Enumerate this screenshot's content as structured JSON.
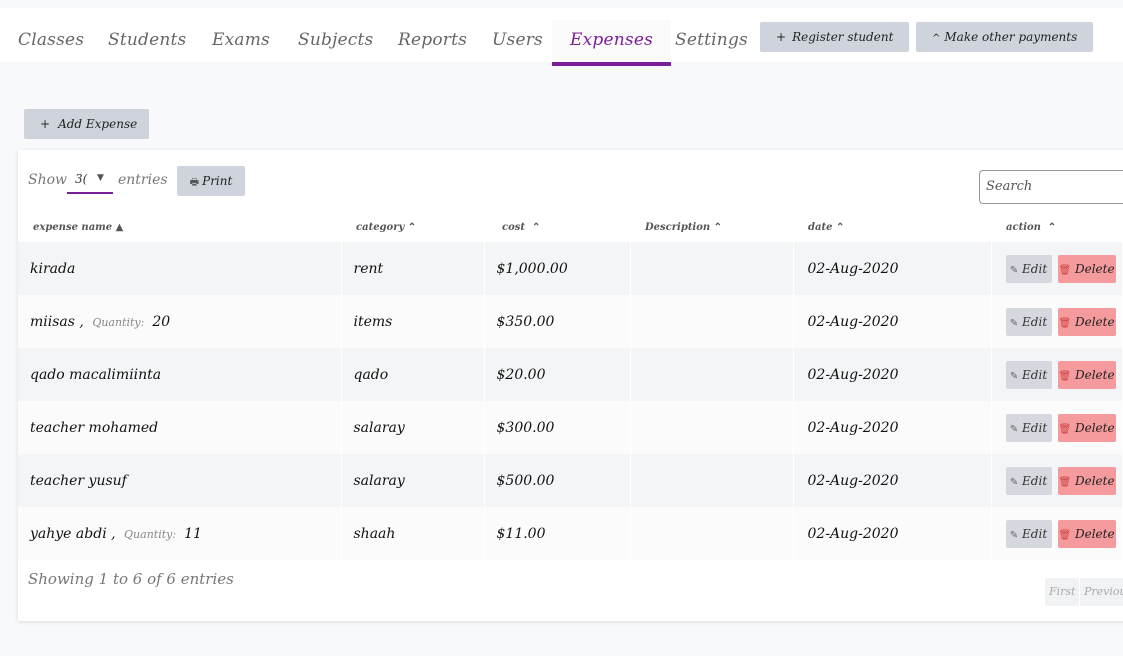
{
  "nav": {
    "tabs": [
      "Classes",
      "Students",
      "Exams",
      "Subjects",
      "Reports",
      "Users",
      "Expenses",
      "Settings"
    ],
    "active_tab": "Expenses",
    "register_label": "Register student",
    "register_icon": "+",
    "other_payments_label": "Make other payments",
    "other_payments_icon": "^"
  },
  "add_expense": {
    "icon": "+",
    "label": "Add Expense"
  },
  "table_controls": {
    "show_label": "Show",
    "page_size": "3(",
    "entries_label": "entries",
    "print_label": "Print",
    "search_placeholder": "Search"
  },
  "columns": [
    "expense name",
    "category",
    "cost",
    "Description",
    "date",
    "action"
  ],
  "rows": [
    {
      "name": "kirada",
      "quantity_label": "",
      "quantity": "",
      "category": "rent",
      "cost": "$1,000.00",
      "description": "",
      "date": "02-Aug-2020"
    },
    {
      "name": "miisas ,",
      "quantity_label": "Quantity:",
      "quantity": "20",
      "category": "items",
      "cost": "$350.00",
      "description": "",
      "date": "02-Aug-2020"
    },
    {
      "name": "qado macalimiinta",
      "quantity_label": "",
      "quantity": "",
      "category": "qado",
      "cost": "$20.00",
      "description": "",
      "date": "02-Aug-2020"
    },
    {
      "name": "teacher mohamed",
      "quantity_label": "",
      "quantity": "",
      "category": "salaray",
      "cost": "$300.00",
      "description": "",
      "date": "02-Aug-2020"
    },
    {
      "name": "teacher yusuf",
      "quantity_label": "",
      "quantity": "",
      "category": "salaray",
      "cost": "$500.00",
      "description": "",
      "date": "02-Aug-2020"
    },
    {
      "name": "yahye abdi ,",
      "quantity_label": "Quantity:",
      "quantity": "11",
      "category": "shaah",
      "cost": "$11.00",
      "description": "",
      "date": "02-Aug-2020"
    }
  ],
  "row_actions": {
    "edit_label": "Edit",
    "delete_label": "Delete"
  },
  "footer": {
    "info": "Showing 1 to 6 of 6 entries",
    "first_label": "First",
    "previous_label": "Previou"
  },
  "colors": {
    "accent": "#7a1e99",
    "button": "#cfd4dc",
    "delete": "#f59a9d"
  }
}
